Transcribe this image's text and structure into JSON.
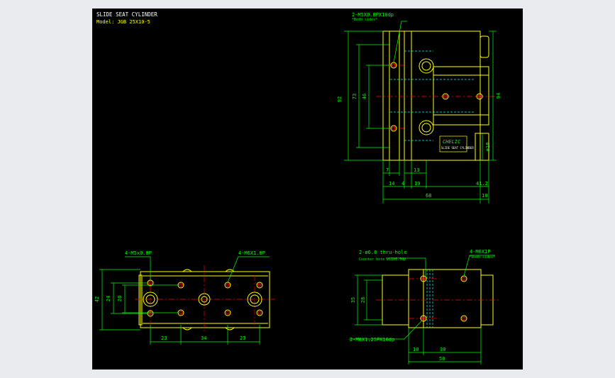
{
  "title": "SLIDE SEAT CYLINDER",
  "model": "Model: JGB 25X10-5",
  "colors": {
    "background": "#000000",
    "outline": "#ffff00",
    "dimension": "#00ff00",
    "centerline": "#ff0000",
    "hidden": "#00ffff"
  },
  "top_view": {
    "label_1": "2-M5X0.8PX10dp",
    "label_1_note": "*Both sides*",
    "dims": {
      "d92": "92",
      "d73": "73",
      "d46": "46",
      "d94": "94",
      "d18": "ø18",
      "d7": "7",
      "d13": "13",
      "d14": "14",
      "d4": "4",
      "d19": "19",
      "d41": "41.2",
      "d68": "68",
      "d10": "10"
    },
    "brand": "CHELIC",
    "brand_sub": "SLIDE SEAT CYLINDER"
  },
  "front_view": {
    "label_m5": "4-M5x0.8P",
    "label_m6": "4-M6X1.0P",
    "dims": {
      "d42": "42",
      "d24": "24",
      "d20": "20",
      "d23a": "23",
      "d34": "34",
      "d23b": "23"
    }
  },
  "side_view": {
    "label_hole": "2-ø6.8  thru-hole",
    "label_cb": "Counter bore ø11X6.5dp",
    "label_m6": "4-M6X1P",
    "label_m6_note": "*Both sides*",
    "label_bottom": "2-M8X1.25PX16dp",
    "dims": {
      "d35": "35",
      "d28": "28",
      "d10": "10",
      "d30": "30",
      "d50": "50"
    }
  }
}
